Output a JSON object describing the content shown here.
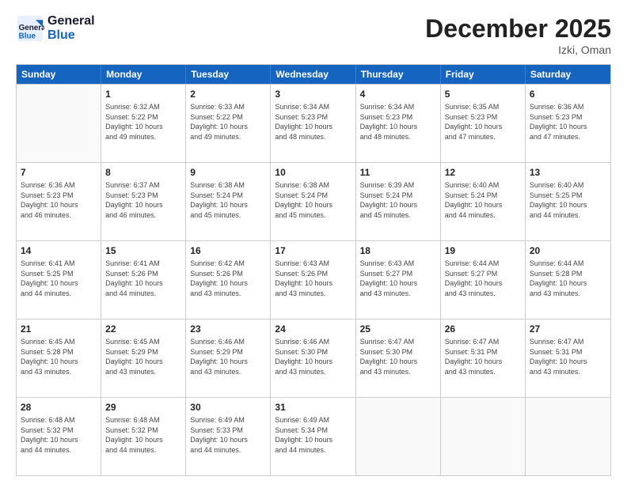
{
  "logo": {
    "line1": "General",
    "line2": "Blue"
  },
  "title": "December 2025",
  "location": "Izki, Oman",
  "header_days": [
    "Sunday",
    "Monday",
    "Tuesday",
    "Wednesday",
    "Thursday",
    "Friday",
    "Saturday"
  ],
  "weeks": [
    [
      {
        "day": "",
        "info": ""
      },
      {
        "day": "1",
        "info": "Sunrise: 6:32 AM\nSunset: 5:22 PM\nDaylight: 10 hours\nand 49 minutes."
      },
      {
        "day": "2",
        "info": "Sunrise: 6:33 AM\nSunset: 5:22 PM\nDaylight: 10 hours\nand 49 minutes."
      },
      {
        "day": "3",
        "info": "Sunrise: 6:34 AM\nSunset: 5:23 PM\nDaylight: 10 hours\nand 48 minutes."
      },
      {
        "day": "4",
        "info": "Sunrise: 6:34 AM\nSunset: 5:23 PM\nDaylight: 10 hours\nand 48 minutes."
      },
      {
        "day": "5",
        "info": "Sunrise: 6:35 AM\nSunset: 5:23 PM\nDaylight: 10 hours\nand 47 minutes."
      },
      {
        "day": "6",
        "info": "Sunrise: 6:36 AM\nSunset: 5:23 PM\nDaylight: 10 hours\nand 47 minutes."
      }
    ],
    [
      {
        "day": "7",
        "info": "Sunrise: 6:36 AM\nSunset: 5:23 PM\nDaylight: 10 hours\nand 46 minutes."
      },
      {
        "day": "8",
        "info": "Sunrise: 6:37 AM\nSunset: 5:23 PM\nDaylight: 10 hours\nand 46 minutes."
      },
      {
        "day": "9",
        "info": "Sunrise: 6:38 AM\nSunset: 5:24 PM\nDaylight: 10 hours\nand 45 minutes."
      },
      {
        "day": "10",
        "info": "Sunrise: 6:38 AM\nSunset: 5:24 PM\nDaylight: 10 hours\nand 45 minutes."
      },
      {
        "day": "11",
        "info": "Sunrise: 6:39 AM\nSunset: 5:24 PM\nDaylight: 10 hours\nand 45 minutes."
      },
      {
        "day": "12",
        "info": "Sunrise: 6:40 AM\nSunset: 5:24 PM\nDaylight: 10 hours\nand 44 minutes."
      },
      {
        "day": "13",
        "info": "Sunrise: 6:40 AM\nSunset: 5:25 PM\nDaylight: 10 hours\nand 44 minutes."
      }
    ],
    [
      {
        "day": "14",
        "info": "Sunrise: 6:41 AM\nSunset: 5:25 PM\nDaylight: 10 hours\nand 44 minutes."
      },
      {
        "day": "15",
        "info": "Sunrise: 6:41 AM\nSunset: 5:26 PM\nDaylight: 10 hours\nand 44 minutes."
      },
      {
        "day": "16",
        "info": "Sunrise: 6:42 AM\nSunset: 5:26 PM\nDaylight: 10 hours\nand 43 minutes."
      },
      {
        "day": "17",
        "info": "Sunrise: 6:43 AM\nSunset: 5:26 PM\nDaylight: 10 hours\nand 43 minutes."
      },
      {
        "day": "18",
        "info": "Sunrise: 6:43 AM\nSunset: 5:27 PM\nDaylight: 10 hours\nand 43 minutes."
      },
      {
        "day": "19",
        "info": "Sunrise: 6:44 AM\nSunset: 5:27 PM\nDaylight: 10 hours\nand 43 minutes."
      },
      {
        "day": "20",
        "info": "Sunrise: 6:44 AM\nSunset: 5:28 PM\nDaylight: 10 hours\nand 43 minutes."
      }
    ],
    [
      {
        "day": "21",
        "info": "Sunrise: 6:45 AM\nSunset: 5:28 PM\nDaylight: 10 hours\nand 43 minutes."
      },
      {
        "day": "22",
        "info": "Sunrise: 6:45 AM\nSunset: 5:29 PM\nDaylight: 10 hours\nand 43 minutes."
      },
      {
        "day": "23",
        "info": "Sunrise: 6:46 AM\nSunset: 5:29 PM\nDaylight: 10 hours\nand 43 minutes."
      },
      {
        "day": "24",
        "info": "Sunrise: 6:46 AM\nSunset: 5:30 PM\nDaylight: 10 hours\nand 43 minutes."
      },
      {
        "day": "25",
        "info": "Sunrise: 6:47 AM\nSunset: 5:30 PM\nDaylight: 10 hours\nand 43 minutes."
      },
      {
        "day": "26",
        "info": "Sunrise: 6:47 AM\nSunset: 5:31 PM\nDaylight: 10 hours\nand 43 minutes."
      },
      {
        "day": "27",
        "info": "Sunrise: 6:47 AM\nSunset: 5:31 PM\nDaylight: 10 hours\nand 43 minutes."
      }
    ],
    [
      {
        "day": "28",
        "info": "Sunrise: 6:48 AM\nSunset: 5:32 PM\nDaylight: 10 hours\nand 44 minutes."
      },
      {
        "day": "29",
        "info": "Sunrise: 6:48 AM\nSunset: 5:32 PM\nDaylight: 10 hours\nand 44 minutes."
      },
      {
        "day": "30",
        "info": "Sunrise: 6:49 AM\nSunset: 5:33 PM\nDaylight: 10 hours\nand 44 minutes."
      },
      {
        "day": "31",
        "info": "Sunrise: 6:49 AM\nSunset: 5:34 PM\nDaylight: 10 hours\nand 44 minutes."
      },
      {
        "day": "",
        "info": ""
      },
      {
        "day": "",
        "info": ""
      },
      {
        "day": "",
        "info": ""
      }
    ]
  ]
}
